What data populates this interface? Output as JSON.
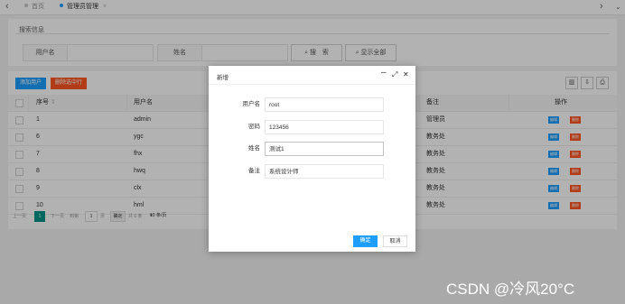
{
  "tabs": [
    {
      "label": "首页",
      "active": false
    },
    {
      "label": "管理员管理",
      "active": true
    }
  ],
  "search": {
    "legend": "搜索信息",
    "username_label": "用户名",
    "name_label": "姓名",
    "search_button": "搜　索",
    "show_all_button": "显示全部"
  },
  "toolbar": {
    "add_label": "添加用户",
    "delete_label": "删除选中行"
  },
  "table": {
    "columns": [
      "序号",
      "用户名",
      "备注",
      "操作"
    ],
    "rows": [
      {
        "id": "1",
        "username": "admin",
        "note": "管理员"
      },
      {
        "id": "6",
        "username": "ygc",
        "note": "教务处"
      },
      {
        "id": "7",
        "username": "fhx",
        "note": "教务处"
      },
      {
        "id": "8",
        "username": "hwq",
        "note": "教务处"
      },
      {
        "id": "9",
        "username": "clx",
        "note": "教务处"
      },
      {
        "id": "10",
        "username": "hml",
        "note": "教务处"
      }
    ],
    "edit_label": "编辑",
    "delete_label": "删除"
  },
  "pager": {
    "prev": "上一页",
    "current": "1",
    "next": "下一页",
    "goto_label": "到第",
    "page_input": "1",
    "page_suffix": "页",
    "confirm": "确定",
    "total": "共 6 条",
    "per_page": "10 条/页"
  },
  "modal": {
    "title": "新增",
    "fields": [
      {
        "label": "用户名",
        "value": "root"
      },
      {
        "label": "密码",
        "value": "123456"
      },
      {
        "label": "姓名",
        "value": "测试1"
      },
      {
        "label": "备注",
        "value": "系统设计师"
      }
    ],
    "ok_label": "确定",
    "cancel_label": "取消"
  },
  "watermark": "CSDN @冷风20°C",
  "colors": {
    "primary": "#1e9fff",
    "danger": "#ff5722",
    "pager_active": "#009688"
  }
}
